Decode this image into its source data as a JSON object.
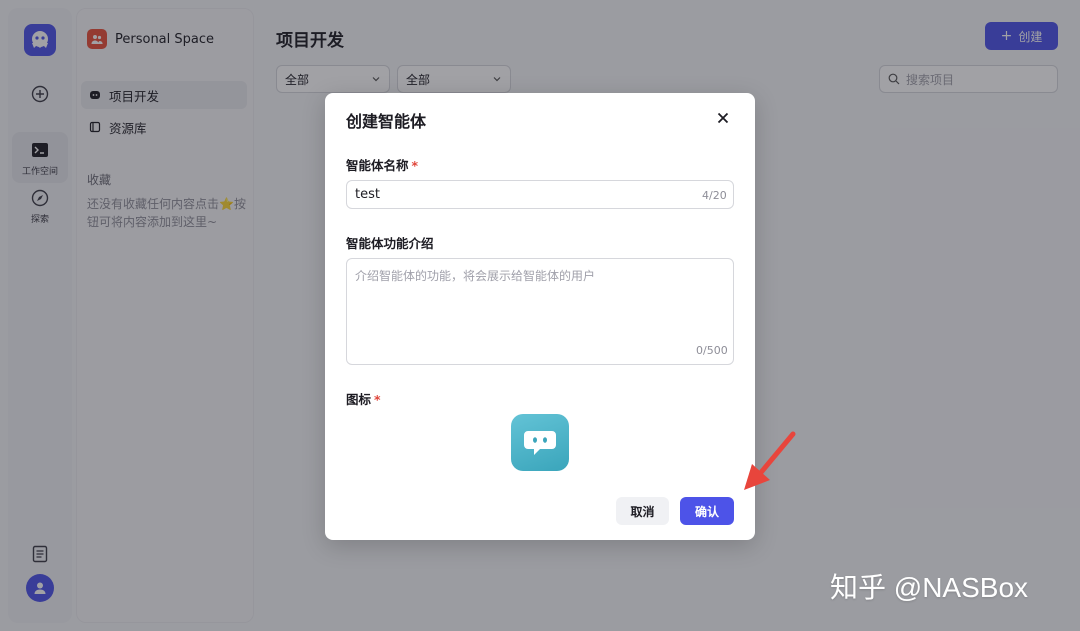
{
  "rail": {
    "items": [
      {
        "icon": "add-icon",
        "label": ""
      },
      {
        "icon": "terminal-icon",
        "label": "工作空间"
      },
      {
        "icon": "compass-icon",
        "label": "探索"
      }
    ]
  },
  "sidebar": {
    "space_name": "Personal Space",
    "nav": [
      {
        "label": "项目开发",
        "icon": "bot-icon",
        "active": true
      },
      {
        "label": "资源库",
        "icon": "library-icon",
        "active": false
      }
    ],
    "favorites_title": "收藏",
    "favorites_empty": "还没有收藏任何内容点击⭐按钮可将内容添加到这里~"
  },
  "header": {
    "title": "项目开发",
    "create_label": "创建"
  },
  "filters": {
    "filter1_value": "全部",
    "filter2_value": "全部",
    "search_placeholder": "搜索项目"
  },
  "modal": {
    "title": "创建智能体",
    "name_label": "智能体名称",
    "name_value": "test",
    "name_counter": "4/20",
    "desc_label": "智能体功能介绍",
    "desc_placeholder": "介绍智能体的功能，将会展示给智能体的用户",
    "desc_counter": "0/500",
    "icon_label": "图标",
    "cancel_label": "取消",
    "confirm_label": "确认"
  },
  "watermark": "知乎 @NASBox",
  "colors": {
    "accent": "#4d53e8",
    "required": "#e0463b",
    "arrow": "#e8453c"
  }
}
